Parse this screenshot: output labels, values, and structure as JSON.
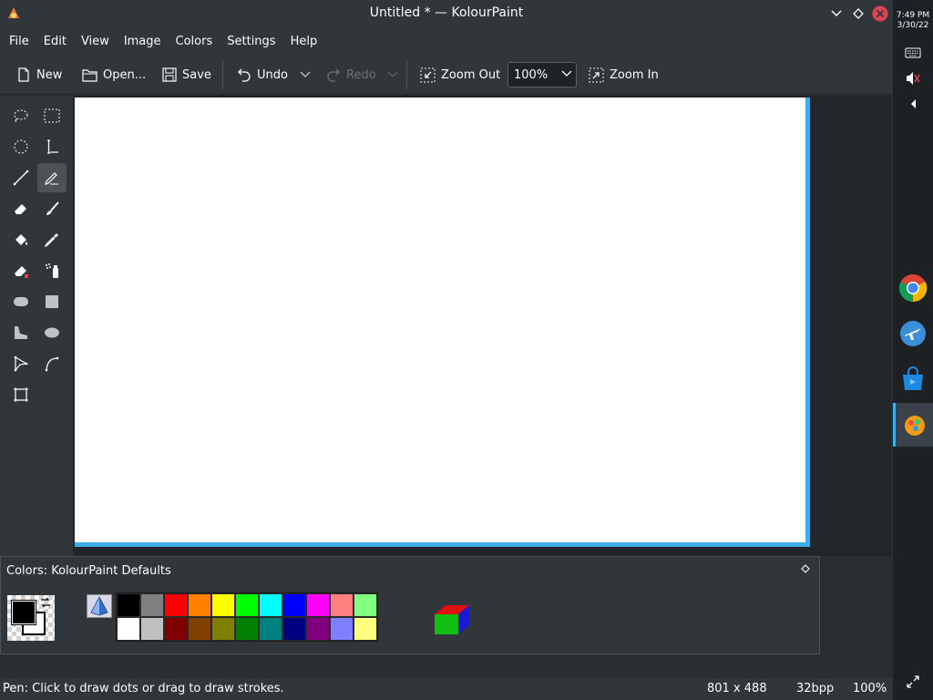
{
  "window": {
    "title": "Untitled * — KolourPaint"
  },
  "menu": [
    "File",
    "Edit",
    "View",
    "Image",
    "Colors",
    "Settings",
    "Help"
  ],
  "toolbar": {
    "new_label": "New",
    "open_label": "Open...",
    "save_label": "Save",
    "undo_label": "Undo",
    "redo_label": "Redo",
    "zoom_out_label": "Zoom Out",
    "zoom_value": "100%",
    "zoom_in_label": "Zoom In"
  },
  "tools": [
    "free-form-selection",
    "rectangular-selection",
    "elliptical-selection",
    "text",
    "line",
    "pen",
    "eraser",
    "brush",
    "flood-fill",
    "color-picker",
    "color-eraser",
    "spraycan",
    "rounded-rectangle",
    "rectangle",
    "polygon",
    "ellipse",
    "connected-lines",
    "curve",
    "autocrop"
  ],
  "active_tool": "pen",
  "colors_panel": {
    "title": "Colors: KolourPaint Defaults",
    "foreground": "#000000",
    "background": "#ffffff",
    "palette_top": [
      "#000000",
      "#808080",
      "#ff0000",
      "#ff8000",
      "#ffff00",
      "#00ff00",
      "#00ffff",
      "#0000ff",
      "#ff00ff",
      "#ff8080",
      "#80ff80"
    ],
    "palette_bottom": [
      "#ffffff",
      "#c0c0c0",
      "#800000",
      "#804000",
      "#808000",
      "#008000",
      "#008080",
      "#000080",
      "#800080",
      "#8080ff",
      "#ffff80"
    ]
  },
  "status": {
    "message": "Pen: Click to draw dots or drag to draw strokes.",
    "size": "801 x 488",
    "bpp": "32bpp",
    "zoom": "100%"
  },
  "panel": {
    "time": "7:49 PM",
    "date": "3/30/22"
  },
  "accent_color": "#3daee9"
}
